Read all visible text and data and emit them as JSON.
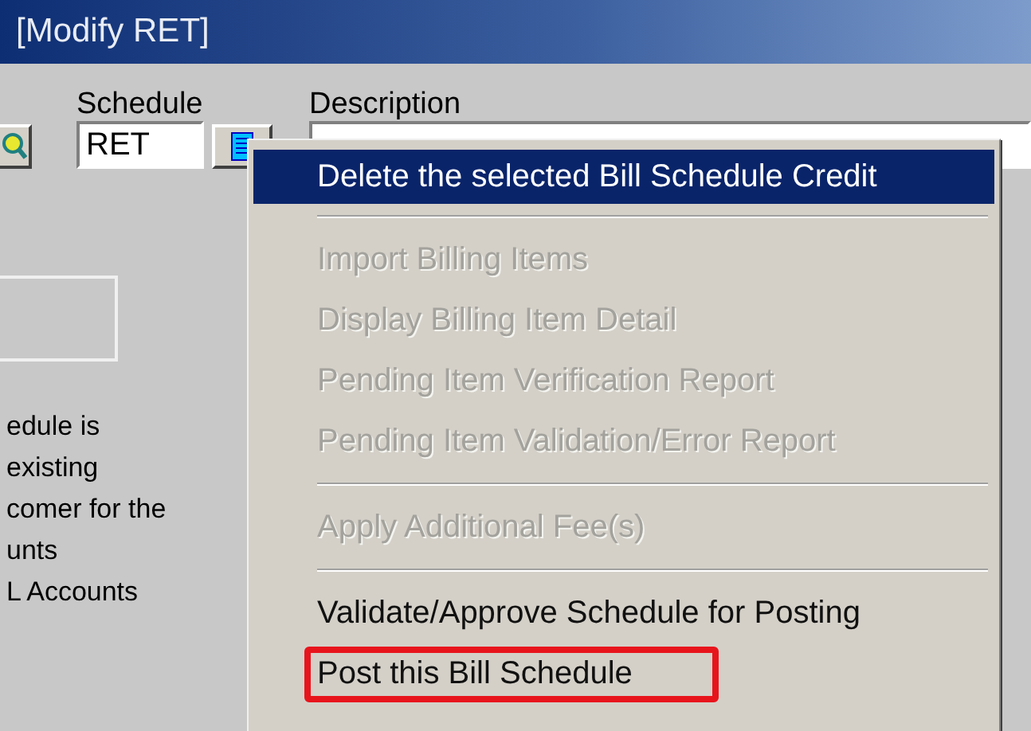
{
  "window": {
    "title": "[Modify RET]"
  },
  "form": {
    "schedule": {
      "label": "Schedule",
      "value": "RET"
    },
    "description": {
      "label": "Description"
    }
  },
  "panel_text": [
    "edule is",
    "existing",
    "comer for the",
    "unts",
    "L Accounts"
  ],
  "context_menu": {
    "items": [
      {
        "kind": "item",
        "label": "Delete the selected Bill Schedule Credit",
        "selected": true,
        "disabled": false,
        "outlined": false
      },
      {
        "kind": "separator"
      },
      {
        "kind": "item",
        "label": "Import Billing Items",
        "selected": false,
        "disabled": true,
        "outlined": false
      },
      {
        "kind": "item",
        "label": "Display Billing Item Detail",
        "selected": false,
        "disabled": true,
        "outlined": false
      },
      {
        "kind": "item",
        "label": "Pending Item Verification Report",
        "selected": false,
        "disabled": true,
        "outlined": false
      },
      {
        "kind": "item",
        "label": "Pending Item Validation/Error Report",
        "selected": false,
        "disabled": true,
        "outlined": false
      },
      {
        "kind": "separator"
      },
      {
        "kind": "item",
        "label": "Apply Additional Fee(s)",
        "selected": false,
        "disabled": true,
        "outlined": false
      },
      {
        "kind": "separator"
      },
      {
        "kind": "item",
        "label": "Validate/Approve Schedule for Posting",
        "selected": false,
        "disabled": false,
        "outlined": false
      },
      {
        "kind": "item",
        "label": "Post this Bill Schedule",
        "selected": false,
        "disabled": false,
        "outlined": true
      }
    ]
  }
}
